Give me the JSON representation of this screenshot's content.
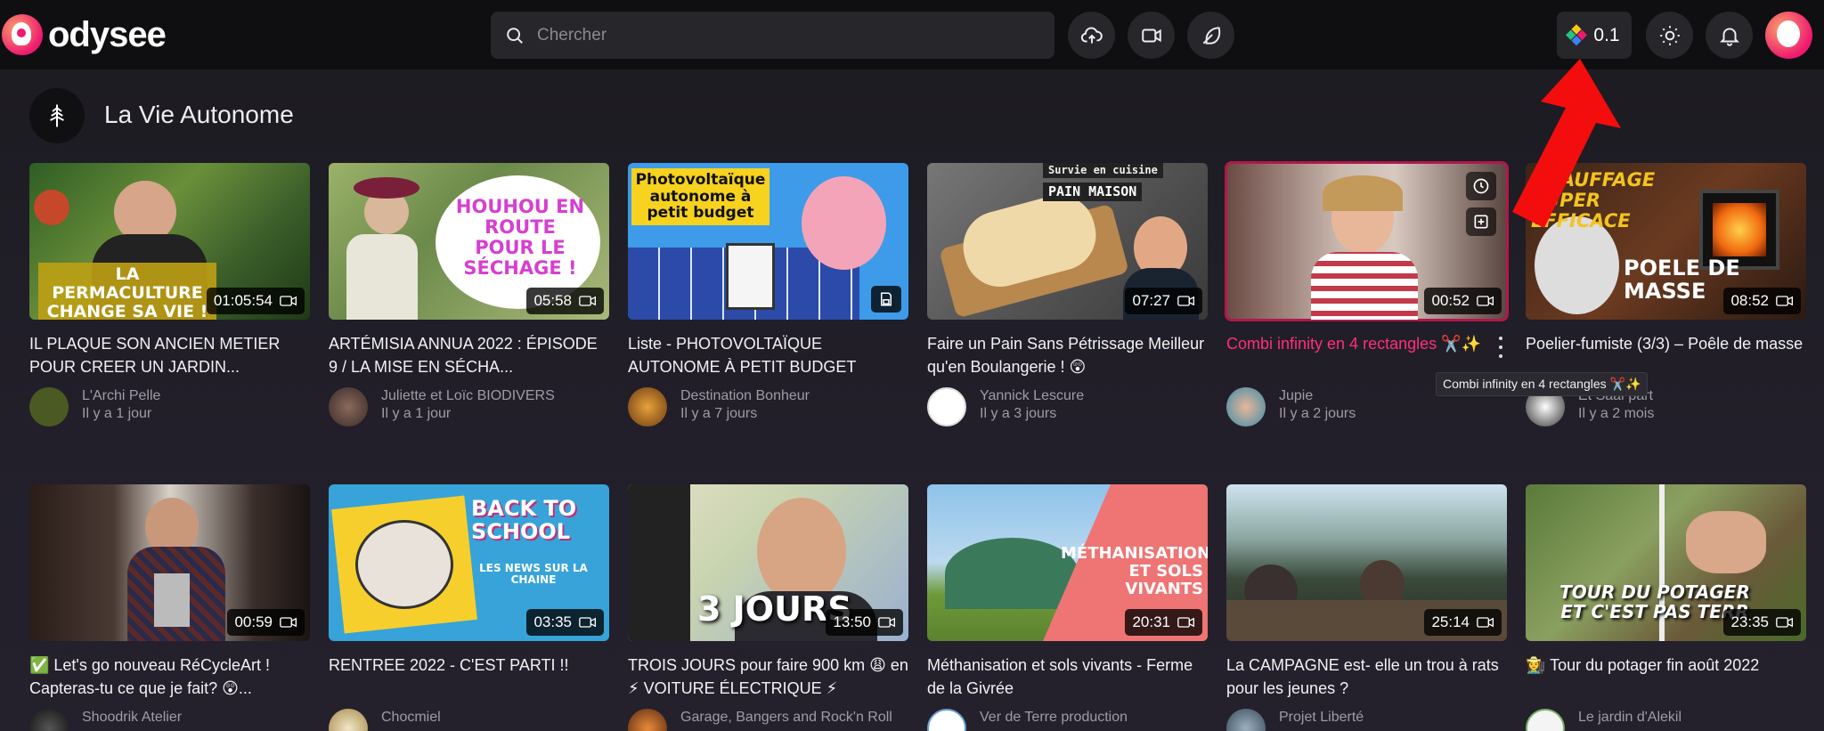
{
  "header": {
    "brand": "odysee",
    "search_placeholder": "Chercher",
    "credits": "0.1",
    "icons": [
      "upload-icon",
      "camera-icon",
      "feather-icon",
      "sun-icon",
      "bell-icon"
    ]
  },
  "channel": {
    "name": "La Vie Autonome"
  },
  "tooltip": "Combi infinity en 4 rectangles ✂️✨",
  "colors": {
    "accent": "#ff2f7c",
    "header_bg": "#0f0f11",
    "page_bg": "#1c1b20"
  },
  "videos": [
    {
      "title": "IL PLAQUE SON ANCIEN METIER POUR CREER UN JARDIN...",
      "channel": "L'Archi Pelle",
      "date": "Il y a 1 jour",
      "duration": "01:05:54",
      "thumb_text": "LA PERMACULTURE CHANGE SA VIE !"
    },
    {
      "title": "ARTÉMISIA ANNUA 2022 : ÉPISODE 9 / LA MISE EN SÉCHA...",
      "channel": "Juliette et Loïc BIODIVERS",
      "date": "Il y a 1 jour",
      "duration": "05:58",
      "thumb_text": "HOUHOU EN ROUTE POUR LE SÉCHAGE !"
    },
    {
      "title": "Liste - PHOTOVOLTAÏQUE AUTONOME À PETIT BUDGET",
      "channel": "Destination Bonheur",
      "date": "Il y a 7 jours",
      "duration": "",
      "thumb_text": "Photovoltaïque autonome à petit budget"
    },
    {
      "title": "Faire un Pain Sans Pétrissage Meilleur qu'en Boulangerie ! 😲",
      "channel": "Yannick Lescure",
      "date": "Il y a 3 jours",
      "duration": "07:27",
      "thumb_text": "PAIN MAISON",
      "thumb_text2": "Survie en cuisine"
    },
    {
      "title": "Combi infinity en 4 rectangles ✂️✨",
      "channel": "Jupie",
      "date": "Il y a 2 jours",
      "duration": "00:52",
      "thumb_text": ""
    },
    {
      "title": "Poelier-fumiste (3/3) – Poêle de masse",
      "channel": "Et Saar'part",
      "date": "Il y a 2 mois",
      "duration": "08:52",
      "thumb_text": "CHAUFFAGE SUPER EFFICACE",
      "thumb_text2": "POELE DE MASSE"
    },
    {
      "title": "✅ Let's go nouveau RéCycleArt ! Capteras-tu ce que je fait? 😲...",
      "channel": "Shoodrik Atelier",
      "date": "",
      "duration": "00:59",
      "thumb_text": ""
    },
    {
      "title": "RENTREE 2022 - C'EST PARTI !!",
      "channel": "Chocmiel",
      "date": "",
      "duration": "03:35",
      "thumb_text": "BACK TO SCHOOL",
      "thumb_text2": "LES NEWS SUR LA CHAINE"
    },
    {
      "title": "TROIS JOURS pour faire 900 km 😩 en ⚡ VOITURE ÉLECTRIQUE ⚡",
      "channel": "Garage, Bangers and Rock'n Roll",
      "date": "",
      "duration": "13:50",
      "thumb_text": "3 JOURS"
    },
    {
      "title": "Méthanisation et sols vivants - Ferme de la Givrée",
      "channel": "Ver de Terre production",
      "date": "",
      "duration": "20:31",
      "thumb_text": "MÉTHANISATION ET SOLS VIVANTS"
    },
    {
      "title": "La CAMPAGNE est- elle un trou à rats pour les jeunes ?",
      "channel": "Projet Liberté",
      "date": "",
      "duration": "25:14",
      "thumb_text": ""
    },
    {
      "title": "👩‍🌾 Tour du potager fin août 2022",
      "channel": "Le jardin d'Alekil",
      "date": "",
      "duration": "23:35",
      "thumb_text": "TOUR DU POTAGER ET C'EST PAS TERR"
    }
  ]
}
